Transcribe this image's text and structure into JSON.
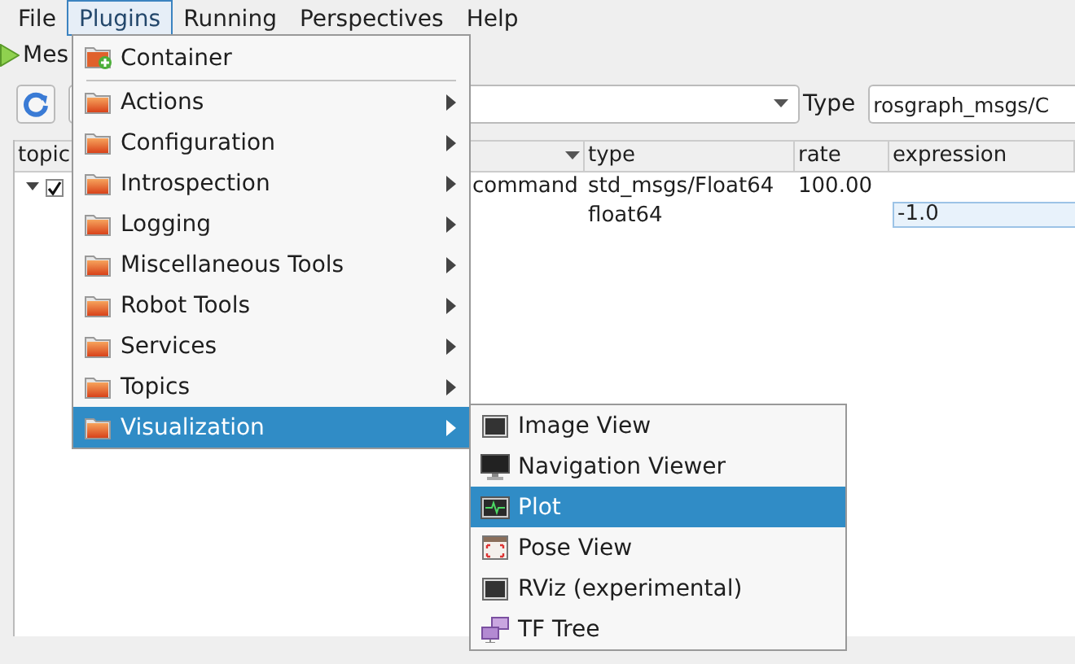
{
  "menubar": [
    {
      "label": "File",
      "selected": false
    },
    {
      "label": "Plugins",
      "selected": true
    },
    {
      "label": "Running",
      "selected": false
    },
    {
      "label": "Perspectives",
      "selected": false
    },
    {
      "label": "Help",
      "selected": false
    }
  ],
  "plugin_tab": {
    "label": "Mes"
  },
  "toolbar": {
    "type_label": "Type",
    "type_field": {
      "value": "rosgraph_msgs/C"
    }
  },
  "table": {
    "columns": [
      "topic",
      "type",
      "rate",
      "expression"
    ],
    "rows": [
      {
        "expanded": true,
        "checked": true,
        "topic": "command",
        "type": "std_msgs/Float64",
        "rate": "100.00",
        "children": [
          {
            "type": "float64",
            "expression": "-1.0"
          }
        ]
      }
    ]
  },
  "plugins_menu": [
    {
      "label": "Container",
      "kind": "container",
      "has_submenu": false,
      "selected": false
    },
    {
      "kind": "separator"
    },
    {
      "label": "Actions",
      "kind": "folder",
      "has_submenu": true,
      "selected": false
    },
    {
      "label": "Configuration",
      "kind": "folder",
      "has_submenu": true,
      "selected": false
    },
    {
      "label": "Introspection",
      "kind": "folder",
      "has_submenu": true,
      "selected": false
    },
    {
      "label": "Logging",
      "kind": "folder",
      "has_submenu": true,
      "selected": false
    },
    {
      "label": "Miscellaneous Tools",
      "kind": "folder",
      "has_submenu": true,
      "selected": false
    },
    {
      "label": "Robot Tools",
      "kind": "folder",
      "has_submenu": true,
      "selected": false
    },
    {
      "label": "Services",
      "kind": "folder",
      "has_submenu": true,
      "selected": false
    },
    {
      "label": "Topics",
      "kind": "folder",
      "has_submenu": true,
      "selected": false
    },
    {
      "label": "Visualization",
      "kind": "folder",
      "has_submenu": true,
      "selected": true
    }
  ],
  "visualization_submenu": [
    {
      "label": "Image View",
      "kind": "monitor",
      "selected": false
    },
    {
      "label": "Navigation Viewer",
      "kind": "display",
      "selected": false
    },
    {
      "label": "Plot",
      "kind": "plot",
      "selected": true
    },
    {
      "label": "Pose View",
      "kind": "pose",
      "selected": false
    },
    {
      "label": "RViz (experimental)",
      "kind": "monitor",
      "selected": false
    },
    {
      "label": "TF Tree",
      "kind": "tf",
      "selected": false
    }
  ]
}
